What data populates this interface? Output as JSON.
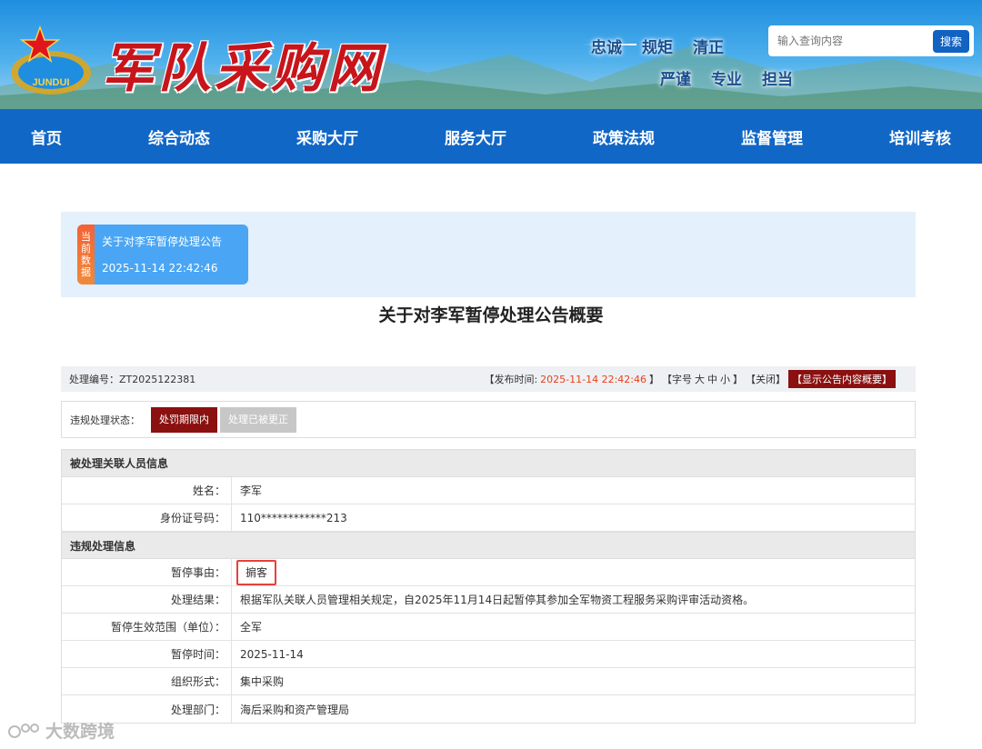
{
  "header": {
    "site_name": "军队采购网",
    "slogans_row1": [
      "忠诚",
      "规矩",
      "清正"
    ],
    "slogans_row2": [
      "严谨",
      "专业",
      "担当"
    ],
    "logo_text": "JUNDUI",
    "search": {
      "placeholder": "输入查询内容",
      "button": "搜索"
    }
  },
  "nav": {
    "items": [
      "首页",
      "综合动态",
      "采购大厅",
      "服务大厅",
      "政策法规",
      "监督管理",
      "培训考核"
    ]
  },
  "current": {
    "tag": "当前数据",
    "title": "关于对李军暂停处理公告",
    "time": "2025-11-14 22:42:46"
  },
  "page_title": "关于对李军暂停处理公告概要",
  "meta": {
    "case_no": "处理编号：ZT2025122381",
    "publish_prefix": "【发布时间:",
    "publish_time": "2025-11-14 22:42:46",
    "bracket_close": "】",
    "font_size_prefix": "【字号",
    "font_large": "大",
    "font_medium": "中",
    "font_small": "小",
    "close_label": "【关闭】",
    "summary_button": "【显示公告内容概要】"
  },
  "status": {
    "label": "违规处理状态：",
    "active": "处罚期限内",
    "inactive": "处理已被更正"
  },
  "person_section": {
    "title": "被处理关联人员信息",
    "rows": [
      {
        "label": "姓名：",
        "value": "李军"
      },
      {
        "label": "身份证号码：",
        "value": "110************213"
      }
    ]
  },
  "violation_section": {
    "title": "违规处理信息",
    "rows": [
      {
        "label": "暂停事由：",
        "value": "掮客"
      },
      {
        "label": "处理结果：",
        "value": "根据军队关联人员管理相关规定，自2025年11月14日起暂停其参加全军物资工程服务采购评审活动资格。"
      },
      {
        "label": "暂停生效范围（单位）：",
        "value": "全军"
      },
      {
        "label": "暂停时间：",
        "value": "2025-11-14"
      },
      {
        "label": "组织形式：",
        "value": "集中采购"
      },
      {
        "label": "处理部门：",
        "value": "海后采购和资产管理局"
      }
    ]
  },
  "watermark": "大数跨境",
  "colors": {
    "nav": "#1167c6",
    "accent_red": "#8b1010",
    "highlight": "#e8403a"
  }
}
